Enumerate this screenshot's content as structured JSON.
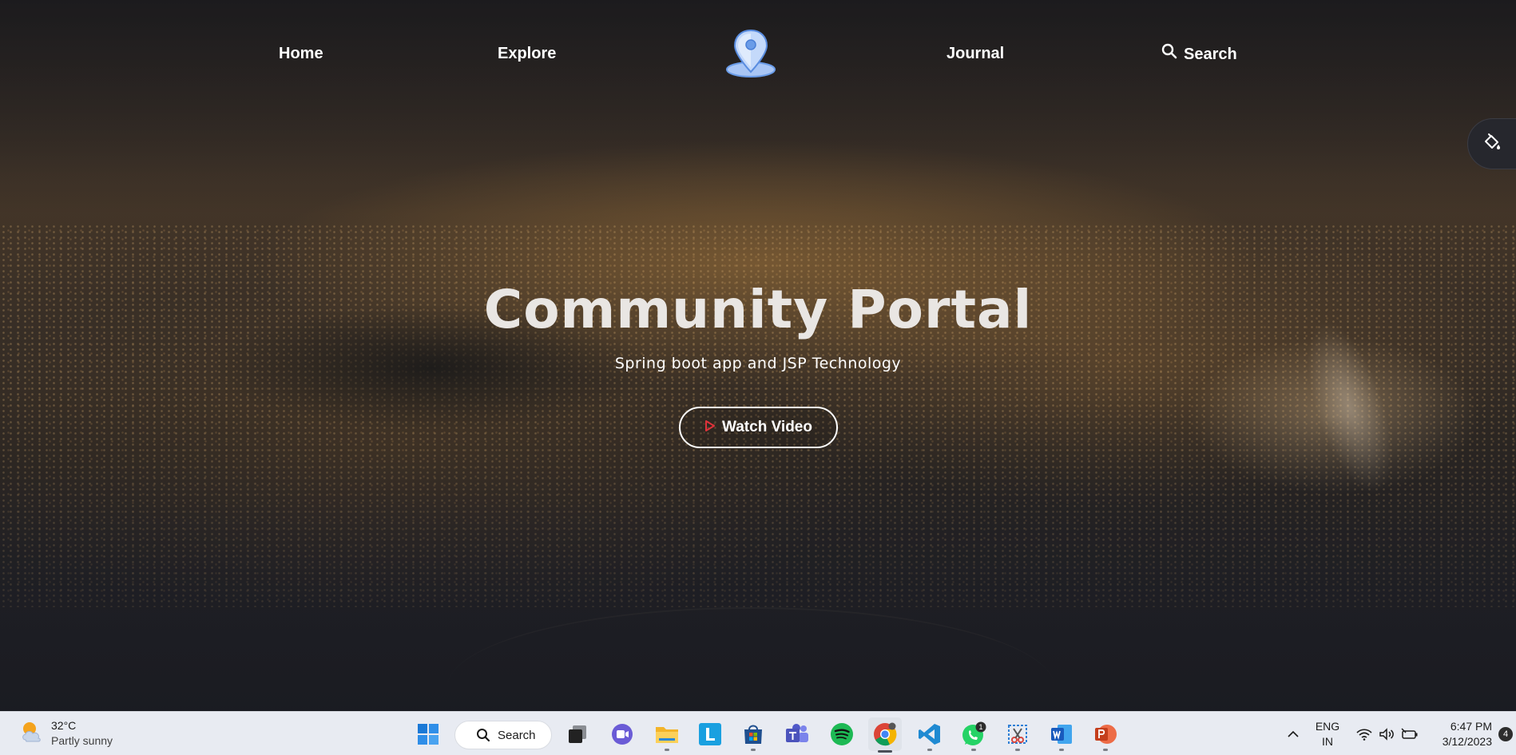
{
  "nav": {
    "home": "Home",
    "explore": "Explore",
    "journal": "Journal",
    "search": "Search"
  },
  "hero": {
    "title": "Community Portal",
    "subtitle": "Spring boot app and JSP Technology",
    "button_label": "Watch Video"
  },
  "taskbar": {
    "weather_temp": "32°C",
    "weather_condition": "Partly sunny",
    "search_label": "Search",
    "apps": [
      "start",
      "search",
      "task-view",
      "teams-chat",
      "file-explorer",
      "l-app",
      "microsoft-store",
      "teams",
      "spotify",
      "chrome",
      "vscode",
      "whatsapp",
      "snipping-tool",
      "word",
      "powerpoint"
    ],
    "whatsapp_badge": "1",
    "lang_top": "ENG",
    "lang_bottom": "IN",
    "time": "6:47 PM",
    "date": "3/12/2023",
    "notification_count": "4"
  },
  "colors": {
    "accent_play": "#e0323a",
    "logo_pin": "#6a9ce8"
  }
}
